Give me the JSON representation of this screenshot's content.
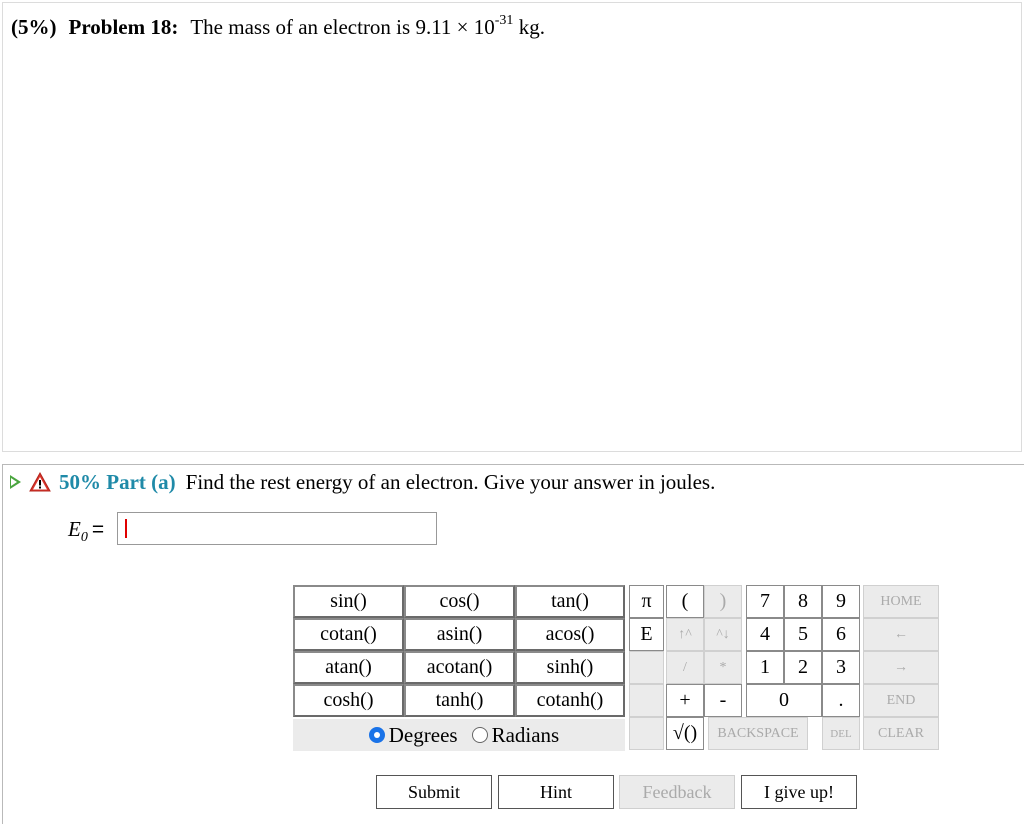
{
  "problem": {
    "percent": "(5%)",
    "number": "Problem 18:",
    "text_prefix": "The mass of an electron is 9.11 × 10",
    "exponent": "-31",
    "unit": " kg."
  },
  "part": {
    "percent": "50% Part (a)",
    "question": "Find the rest energy of an electron. Give your answer in joules.",
    "answer_symbol": "E",
    "answer_subscript": "0",
    "equals": "=",
    "answer_value": ""
  },
  "calculator": {
    "functions": [
      [
        "sin()",
        "cos()",
        "tan()"
      ],
      [
        "cotan()",
        "asin()",
        "acos()"
      ],
      [
        "atan()",
        "acotan()",
        "sinh()"
      ],
      [
        "cosh()",
        "tanh()",
        "cotanh()"
      ]
    ],
    "angle_mode": {
      "degrees": "Degrees",
      "radians": "Radians",
      "selected": "Degrees"
    },
    "keys": {
      "pi": "π",
      "open_paren": "(",
      "close_paren": ")",
      "e": "E",
      "up": "↑^",
      "down": "^↓",
      "divide": "/",
      "multiply": "*",
      "plus": "+",
      "minus": "-",
      "sqrt": "√()",
      "n7": "7",
      "n8": "8",
      "n9": "9",
      "n4": "4",
      "n5": "5",
      "n6": "6",
      "n1": "1",
      "n2": "2",
      "n3": "3",
      "n0": "0",
      "dot": ".",
      "home": "HOME",
      "left": "←",
      "right": "→",
      "end": "END",
      "backspace": "BACKSPACE",
      "del": "DEL",
      "clear": "CLEAR"
    }
  },
  "actions": {
    "submit": "Submit",
    "hint": "Hint",
    "feedback": "Feedback",
    "give_up": "I give up!"
  },
  "colors": {
    "accent": "#1f8aa8",
    "play": "#4aa53f",
    "warning": "#d9342b",
    "radio": "#1a73e8"
  }
}
